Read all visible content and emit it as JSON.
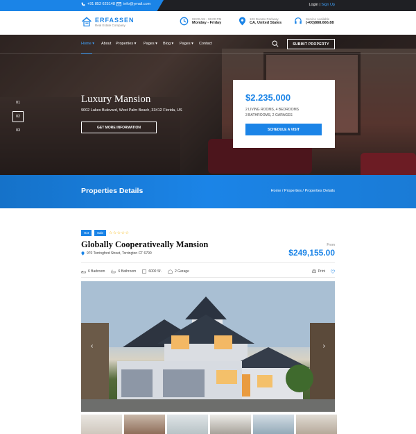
{
  "topbar": {
    "phone": "+91 852 625148",
    "email": "info@ymail.com",
    "login": "Login",
    "sep": " | ",
    "signup": "Sign Up"
  },
  "header": {
    "logo_name": "ERFASSEN",
    "logo_sub": "Real Estate Company",
    "hours_l1": "08:00 AM - 06:00 PM",
    "hours_l2": "Monday - Friday",
    "addr_l1": "103 Donato Parkway",
    "addr_l2": "CA, United States",
    "service_l1": "Service Available",
    "service_l2": "(+00)888.666.88"
  },
  "nav": {
    "items": [
      "Home",
      "About",
      "Properties",
      "Pages",
      "Blog",
      "Pages",
      "Contact"
    ],
    "submit": "SUBMIT PROPERTY"
  },
  "hero": {
    "slides": [
      "01",
      "02",
      "03"
    ],
    "title": "Luxury Mansion",
    "address": "9002 Lakes Bulevard, West Palm Beach, 33412 Florida, US",
    "button": "GET MORE INFORMATION",
    "card_price": "$2.235.000",
    "card_line1": "2 LIVING ROOMS, 4 BEDROOMS",
    "card_line2": "3 BATHROOMS, 2 GARAGES",
    "card_button": "SCHEDULE A VISIT"
  },
  "banner": {
    "title": "Properties Details",
    "crumb": "Home / Properties / Properties Details"
  },
  "property": {
    "badge1": "Hot",
    "badge2": "Sale",
    "stars": "☆☆☆☆☆",
    "title": "Globally Cooperativeally Mansion",
    "address": "970 Torringford Street, Torrington CT 6790",
    "from": "From",
    "price": "$249,155.00",
    "features": [
      "6 Badroom",
      "6 Bathroom",
      "6000 Sf.",
      "2 Garage"
    ],
    "print": "Print"
  },
  "colors": {
    "accent": "#1b84e7",
    "dark": "#1f2024",
    "star": "#f5b400"
  }
}
